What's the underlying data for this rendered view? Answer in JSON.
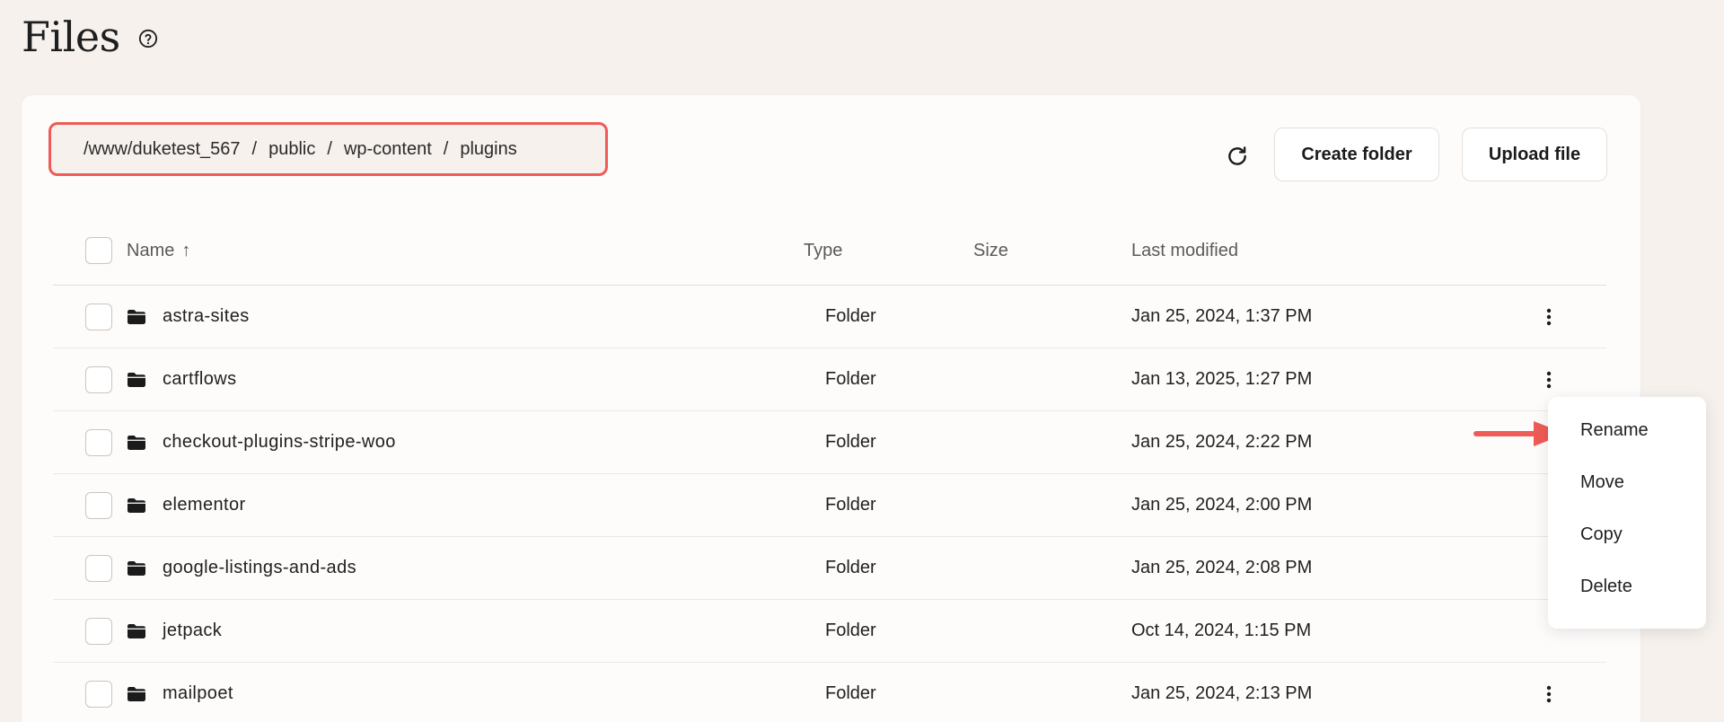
{
  "header": {
    "title": "Files",
    "help_icon": "help-circle-icon"
  },
  "breadcrumb": {
    "segments": [
      "/www/duketest_567",
      "public",
      "wp-content",
      "plugins"
    ],
    "separator": "/",
    "highlight_color": "#ef5b57"
  },
  "toolbar": {
    "refresh_icon": "refresh-icon",
    "create_folder_label": "Create folder",
    "upload_file_label": "Upload file"
  },
  "table": {
    "columns": {
      "name": "Name",
      "sort_indicator": "↑",
      "type": "Type",
      "size": "Size",
      "last_modified": "Last modified"
    },
    "rows": [
      {
        "name": "astra-sites",
        "type": "Folder",
        "size": "",
        "modified": "Jan 25, 2024, 1:37 PM",
        "has_menu": true
      },
      {
        "name": "cartflows",
        "type": "Folder",
        "size": "",
        "modified": "Jan 13, 2025, 1:27 PM",
        "has_menu": true
      },
      {
        "name": "checkout-plugins-stripe-woo",
        "type": "Folder",
        "size": "",
        "modified": "Jan 25, 2024, 2:22 PM",
        "has_menu": false
      },
      {
        "name": "elementor",
        "type": "Folder",
        "size": "",
        "modified": "Jan 25, 2024, 2:00 PM",
        "has_menu": false
      },
      {
        "name": "google-listings-and-ads",
        "type": "Folder",
        "size": "",
        "modified": "Jan 25, 2024, 2:08 PM",
        "has_menu": false
      },
      {
        "name": "jetpack",
        "type": "Folder",
        "size": "",
        "modified": "Oct 14, 2024, 1:15 PM",
        "has_menu": false
      },
      {
        "name": "mailpoet",
        "type": "Folder",
        "size": "",
        "modified": "Jan 25, 2024, 2:13 PM",
        "has_menu": true
      }
    ]
  },
  "context_menu": {
    "items": [
      "Rename",
      "Move",
      "Copy",
      "Delete"
    ]
  },
  "annotation": {
    "arrow_color": "#ef5b57"
  }
}
